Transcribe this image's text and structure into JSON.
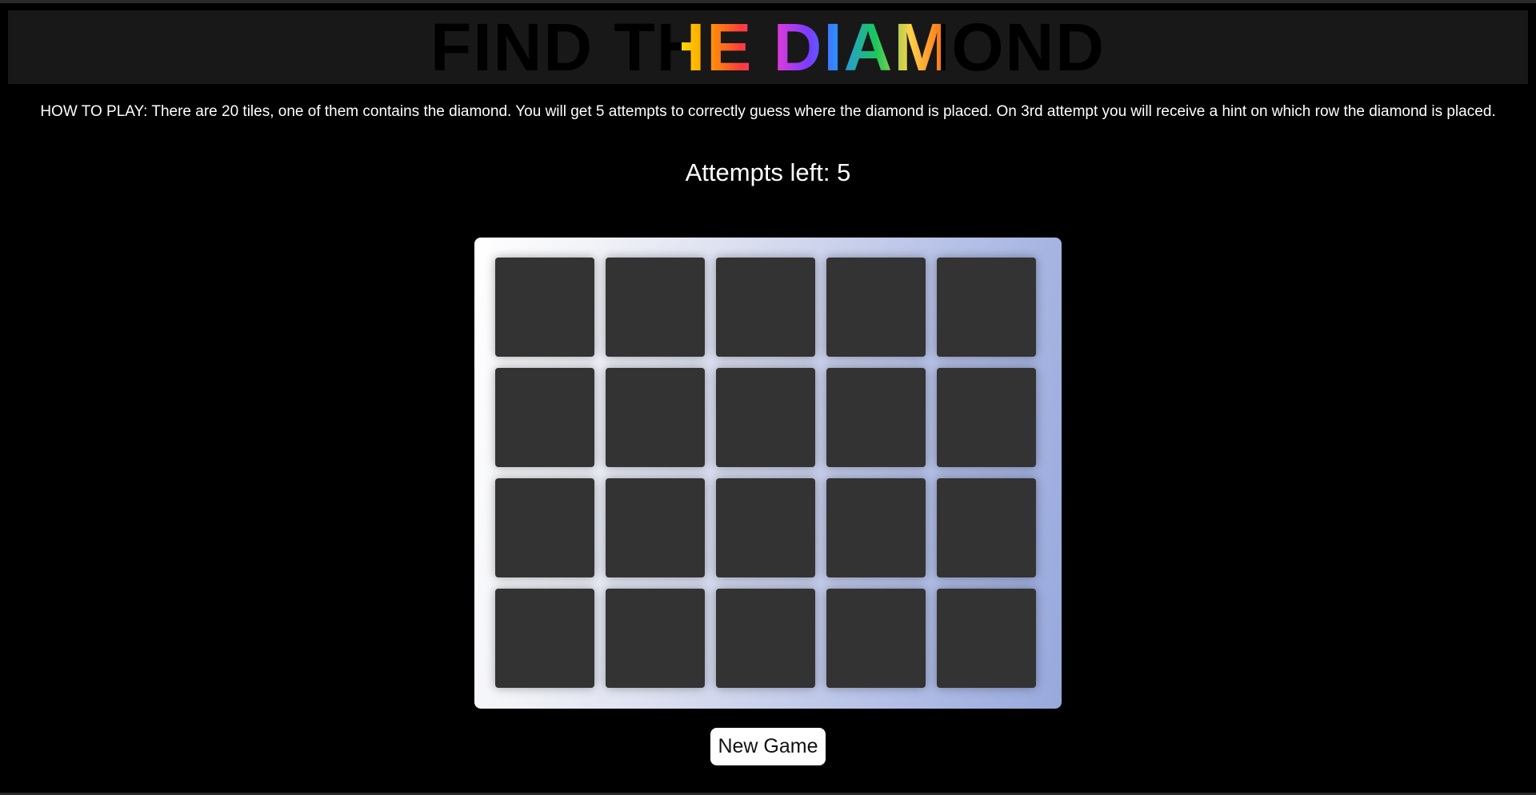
{
  "header": {
    "title": "FIND THE DIAMOND"
  },
  "instructions": {
    "text": "HOW TO PLAY: There are 20 tiles, one of them contains the diamond. You will get 5 attempts to correctly guess where the diamond is placed. On 3rd attempt you will receive a hint on which row the diamond is placed."
  },
  "status": {
    "attempts_text": "Attempts left: 5"
  },
  "board": {
    "rows": 4,
    "columns": 5,
    "tile_color": "#333333"
  },
  "controls": {
    "new_game_label": "New Game"
  }
}
